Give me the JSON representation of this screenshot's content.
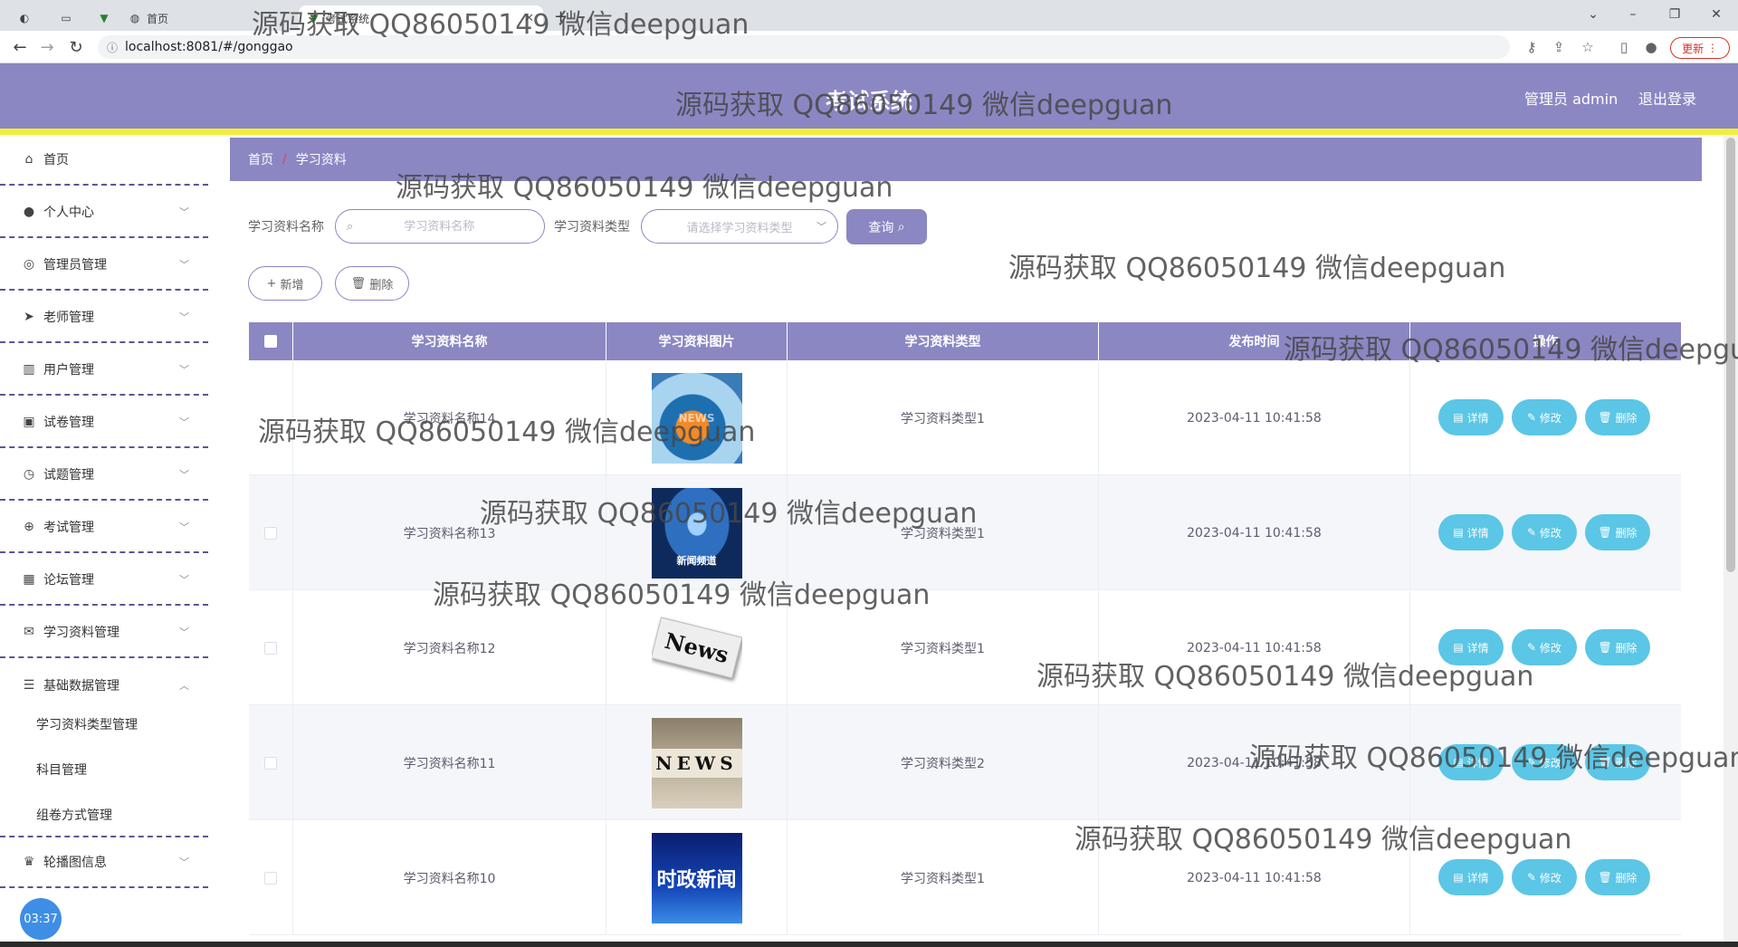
{
  "browser": {
    "tabs": [
      {
        "icon": "circle-icon",
        "label": ""
      },
      {
        "icon": "doc-icon",
        "label": ""
      },
      {
        "icon": "vue-icon",
        "label": ""
      },
      {
        "icon": "globe-icon",
        "label": "首页"
      }
    ],
    "active_tab": {
      "label": "考试系统"
    },
    "url": "localhost:8081/#/gonggao",
    "update_label": "更新"
  },
  "header": {
    "title": "考试系统",
    "admin_label": "管理员 admin",
    "logout_label": "退出登录",
    "bar_color": "#8b87c3",
    "accent_line_color": "#f4ee3b"
  },
  "sidebar": {
    "items": [
      {
        "label": "首页",
        "icon": "home-icon"
      },
      {
        "label": "个人中心",
        "icon": "user-icon"
      },
      {
        "label": "管理员管理",
        "icon": "compass-icon"
      },
      {
        "label": "老师管理",
        "icon": "send-icon"
      },
      {
        "label": "用户管理",
        "icon": "chart-icon"
      },
      {
        "label": "试卷管理",
        "icon": "clipboard-icon"
      },
      {
        "label": "试题管理",
        "icon": "clock-icon"
      },
      {
        "label": "考试管理",
        "icon": "target-icon"
      },
      {
        "label": "论坛管理",
        "icon": "grid-icon"
      },
      {
        "label": "学习资料管理",
        "icon": "mail-icon"
      },
      {
        "label": "基础数据管理",
        "icon": "sliders-icon"
      },
      {
        "label": "轮播图信息",
        "icon": "trophy-icon"
      }
    ],
    "sub_items": [
      "学习资料类型管理",
      "科目管理",
      "组卷方式管理"
    ],
    "clock": "03:37"
  },
  "breadcrumb": {
    "home": "首页",
    "separator": "/",
    "current": "学习资料"
  },
  "search": {
    "name_label": "学习资料名称",
    "name_placeholder": "学习资料名称",
    "type_label": "学习资料类型",
    "type_placeholder": "请选择学习资料类型",
    "search_button": "查询"
  },
  "actions": {
    "add": "新增",
    "delete": "删除"
  },
  "table": {
    "columns": [
      "学习资料名称",
      "学习资料图片",
      "学习资料类型",
      "发布时间",
      "操作"
    ],
    "rows": [
      {
        "name": "学习资料名称14",
        "image": "news-globe",
        "image_text": "NEWS",
        "type": "学习资料类型1",
        "time": "2023-04-11 10:41:58"
      },
      {
        "name": "学习资料名称13",
        "image": "news-broadcast",
        "image_text": "新闻频道",
        "type": "学习资料类型1",
        "time": "2023-04-11 10:41:58"
      },
      {
        "name": "学习资料名称12",
        "image": "newspaper",
        "image_text": "News",
        "type": "学习资料类型1",
        "time": "2023-04-11 10:41:58"
      },
      {
        "name": "学习资料名称11",
        "image": "news-blocks",
        "image_text": "NEWS",
        "type": "学习资料类型2",
        "time": "2023-04-11 10:41:58"
      },
      {
        "name": "学习资料名称10",
        "image": "shizheng-news",
        "image_text": "时政新闻",
        "type": "学习资料类型1",
        "time": "2023-04-11 10:41:58"
      }
    ],
    "row_actions": {
      "detail": "详情",
      "edit": "修改",
      "delete": "删除"
    }
  },
  "watermark": "源码获取 QQ86050149 微信deepguan"
}
